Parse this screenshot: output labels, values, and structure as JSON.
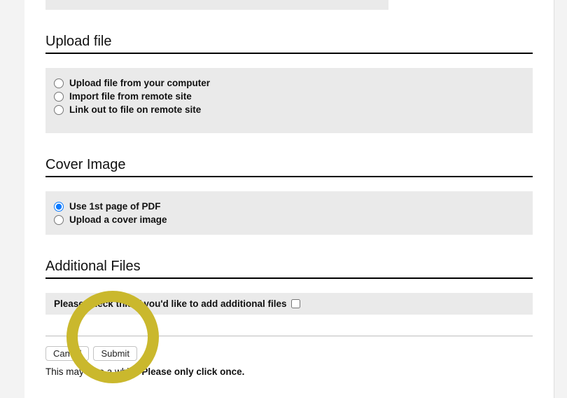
{
  "sections": {
    "upload_file": {
      "title": "Upload file",
      "options": [
        "Upload file from your computer",
        "Import file from remote site",
        "Link out to file on remote site"
      ]
    },
    "cover_image": {
      "title": "Cover Image",
      "options": [
        "Use 1st page of PDF",
        "Upload a cover image"
      ]
    },
    "additional_files": {
      "title": "Additional Files",
      "checkbox_label": "Please check this if you'd like to add additional files"
    }
  },
  "buttons": {
    "cancel": "Cancel",
    "submit": "Submit"
  },
  "notice": {
    "part1": "This may take a while. ",
    "part2": "Please only click once."
  }
}
